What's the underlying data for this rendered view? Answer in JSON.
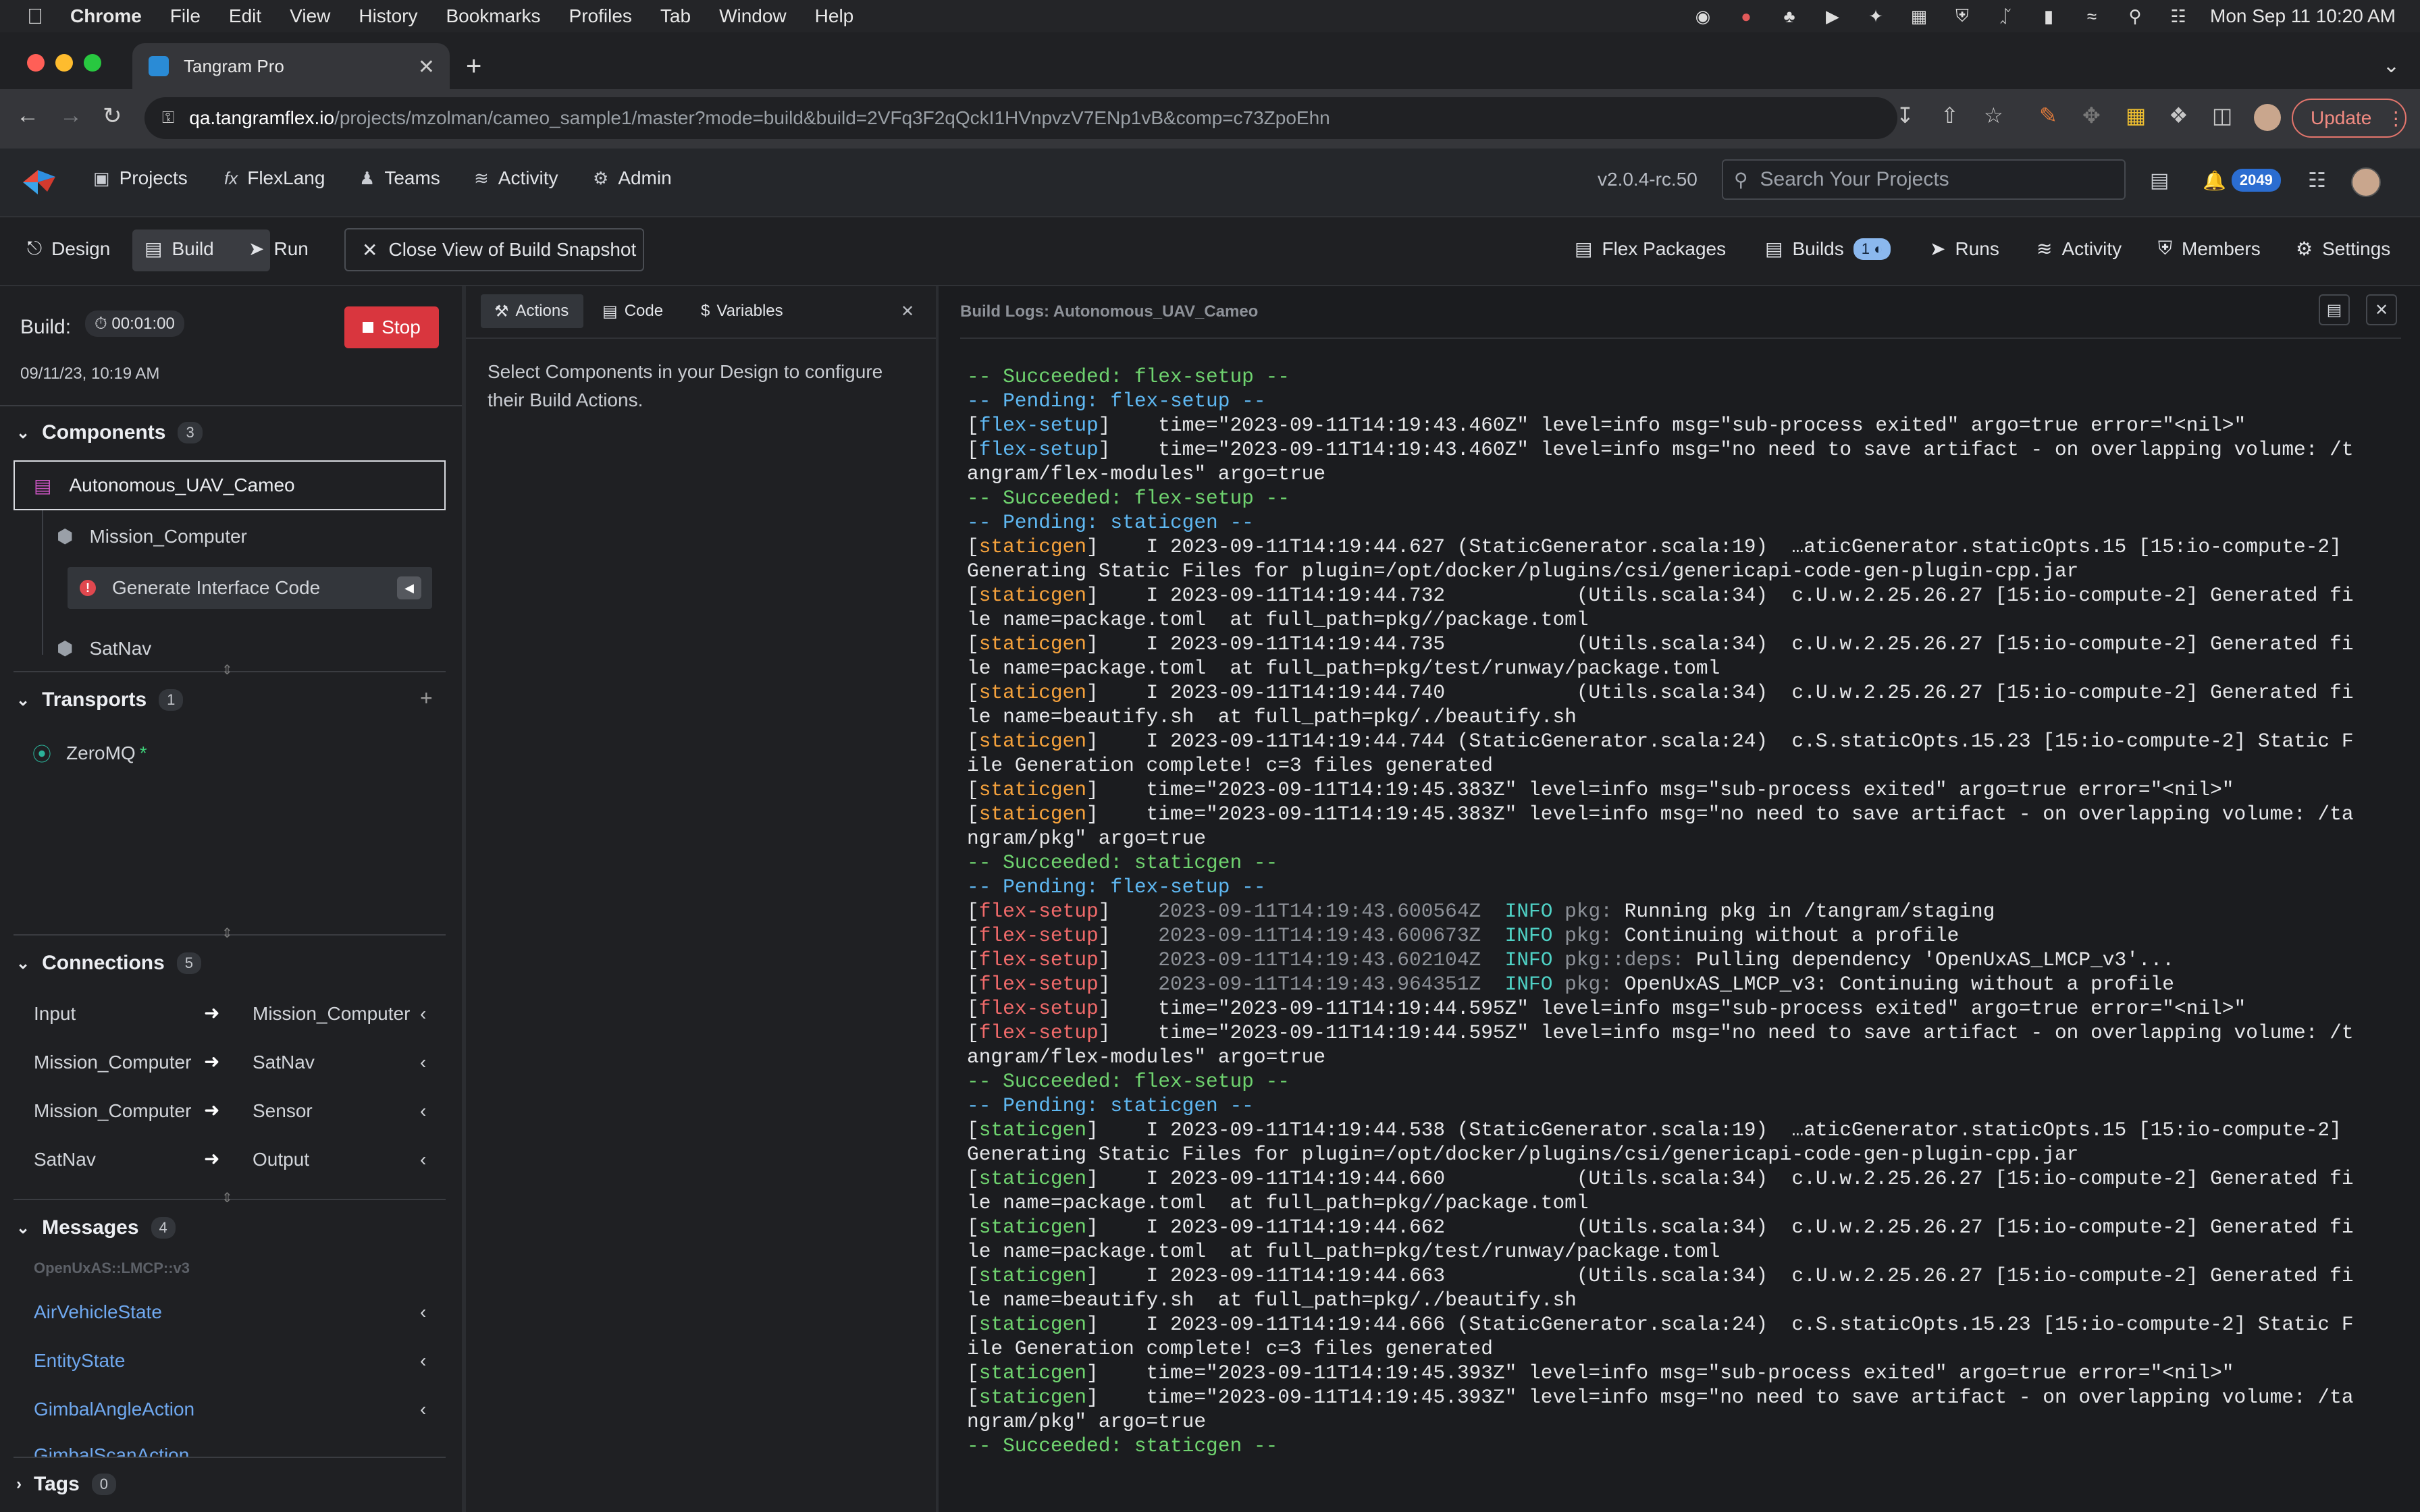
{
  "menubar": {
    "items": [
      "Chrome",
      "File",
      "Edit",
      "View",
      "History",
      "Bookmarks",
      "Profiles",
      "Tab",
      "Window",
      "Help"
    ],
    "clock": "Mon Sep 11  10:20 AM"
  },
  "browser": {
    "tab_title": "Tangram Pro",
    "url_host": "qa.tangramflex.io",
    "url_path": "/projects/mzolman/cameo_sample1/master?mode=build&build=2VFq3F2qQckI1HVnpvzV7ENp1vB&comp=c73ZpoEhn",
    "update_label": "Update"
  },
  "app_header": {
    "nav": [
      {
        "label": "Projects",
        "icon": "projects-icon"
      },
      {
        "label": "FlexLang",
        "icon": "fx-icon"
      },
      {
        "label": "Teams",
        "icon": "teams-icon"
      },
      {
        "label": "Activity",
        "icon": "activity-icon"
      },
      {
        "label": "Admin",
        "icon": "gear-icon"
      }
    ],
    "version": "v2.0.4-rc.50",
    "search_placeholder": "Search Your Projects",
    "notifications": "2049"
  },
  "project_header": {
    "modes": [
      "Design",
      "Build",
      "Run"
    ],
    "close_view": "Close View of Build Snapshot",
    "right_nav": [
      {
        "label": "Flex Packages"
      },
      {
        "label": "Builds",
        "badge": "1"
      },
      {
        "label": "Runs"
      },
      {
        "label": "Activity"
      },
      {
        "label": "Members"
      },
      {
        "label": "Settings"
      }
    ]
  },
  "build": {
    "label": "Build:",
    "timer": "00:01:00",
    "stop_label": "Stop",
    "date": "09/11/23, 10:19 AM"
  },
  "components": {
    "title": "Components",
    "count": "3",
    "selected": "Autonomous_UAV_Cameo",
    "items": [
      "Mission_Computer",
      "SatNav"
    ],
    "action": "Generate Interface Code"
  },
  "transports": {
    "title": "Transports",
    "count": "1",
    "items": [
      {
        "label": "ZeroMQ",
        "marker": "*"
      }
    ]
  },
  "connections": {
    "title": "Connections",
    "count": "5",
    "rows": [
      {
        "from": "Input",
        "to": "Mission_Computer"
      },
      {
        "from": "Mission_Computer",
        "to": "SatNav"
      },
      {
        "from": "Mission_Computer",
        "to": "Sensor"
      },
      {
        "from": "SatNav",
        "to": "Output"
      }
    ]
  },
  "messages": {
    "title": "Messages",
    "count": "4",
    "namespace": "OpenUxAS::LMCP::v3",
    "items": [
      "AirVehicleState",
      "EntityState",
      "GimbalAngleAction",
      "GimbalScanAction"
    ]
  },
  "tags": {
    "title": "Tags",
    "count": "0"
  },
  "middle": {
    "tabs": [
      "Actions",
      "Code",
      "Variables"
    ],
    "hint": "Select Components in your Design to configure their Build Actions."
  },
  "logs": {
    "title": "Build Logs: Autonomous_UAV_Cameo",
    "lines": [
      [
        [
          "-- Succeeded: flex-setup --",
          "g"
        ]
      ],
      [
        [
          "-- Pending: flex-setup --",
          "c"
        ]
      ],
      [
        [
          "[",
          "w"
        ],
        [
          "flex-setup",
          "c"
        ],
        [
          "]    time=\"2023-09-11T14:19:43.460Z\" level=info msg=\"sub-process exited\" argo=true error=\"<nil>\"",
          "w"
        ]
      ],
      [
        [
          "[",
          "w"
        ],
        [
          "flex-setup",
          "c"
        ],
        [
          "]    time=\"2023-09-11T14:19:43.460Z\" level=info msg=\"no need to save artifact - on overlapping volume: /t",
          "w"
        ]
      ],
      [
        [
          "angram/flex-modules\" argo=true",
          "w"
        ]
      ],
      [
        [
          "-- Succeeded: flex-setup --",
          "g"
        ]
      ],
      [
        [
          "-- Pending: staticgen --",
          "c"
        ]
      ],
      [
        [
          "[",
          "w"
        ],
        [
          "staticgen",
          "o"
        ],
        [
          "]    I 2023-09-11T14:19:44.627 (StaticGenerator.scala:19)  …aticGenerator.staticOpts.15 [15:io-compute-2]",
          "w"
        ]
      ],
      [
        [
          "Generating Static Files for plugin=/opt/docker/plugins/csi/genericapi-code-gen-plugin-cpp.jar",
          "w"
        ]
      ],
      [
        [
          "[",
          "w"
        ],
        [
          "staticgen",
          "o"
        ],
        [
          "]    I 2023-09-11T14:19:44.732           (Utils.scala:34)  c.U.w.2.25.26.27 [15:io-compute-2] Generated fi",
          "w"
        ]
      ],
      [
        [
          "le name=package.toml  at full_path=pkg//package.toml",
          "w"
        ]
      ],
      [
        [
          "[",
          "w"
        ],
        [
          "staticgen",
          "o"
        ],
        [
          "]    I 2023-09-11T14:19:44.735           (Utils.scala:34)  c.U.w.2.25.26.27 [15:io-compute-2] Generated fi",
          "w"
        ]
      ],
      [
        [
          "le name=package.toml  at full_path=pkg/test/runway/package.toml",
          "w"
        ]
      ],
      [
        [
          "[",
          "w"
        ],
        [
          "staticgen",
          "o"
        ],
        [
          "]    I 2023-09-11T14:19:44.740           (Utils.scala:34)  c.U.w.2.25.26.27 [15:io-compute-2] Generated fi",
          "w"
        ]
      ],
      [
        [
          "le name=beautify.sh  at full_path=pkg/./beautify.sh",
          "w"
        ]
      ],
      [
        [
          "[",
          "w"
        ],
        [
          "staticgen",
          "o"
        ],
        [
          "]    I 2023-09-11T14:19:44.744 (StaticGenerator.scala:24)  c.S.staticOpts.15.23 [15:io-compute-2] Static F",
          "w"
        ]
      ],
      [
        [
          "ile Generation complete! c=3 files generated",
          "w"
        ]
      ],
      [
        [
          "[",
          "w"
        ],
        [
          "staticgen",
          "o"
        ],
        [
          "]    time=\"2023-09-11T14:19:45.383Z\" level=info msg=\"sub-process exited\" argo=true error=\"<nil>\"",
          "w"
        ]
      ],
      [
        [
          "[",
          "w"
        ],
        [
          "staticgen",
          "o"
        ],
        [
          "]    time=\"2023-09-11T14:19:45.383Z\" level=info msg=\"no need to save artifact - on overlapping volume: /ta",
          "w"
        ]
      ],
      [
        [
          "ngram/pkg\" argo=true",
          "w"
        ]
      ],
      [
        [
          "-- Succeeded: staticgen --",
          "g"
        ]
      ],
      [
        [
          "-- Pending: flex-setup --",
          "c"
        ]
      ],
      [
        [
          "[",
          "w"
        ],
        [
          "flex-setup",
          "r"
        ],
        [
          "]    ",
          "w"
        ],
        [
          "2023-09-11T14:19:43.600564Z",
          "d"
        ],
        [
          "  ",
          "w"
        ],
        [
          "INFO",
          "t"
        ],
        [
          " ",
          "w"
        ],
        [
          "pkg:",
          "d"
        ],
        [
          " Running pkg in /tangram/staging",
          "w"
        ]
      ],
      [
        [
          "[",
          "w"
        ],
        [
          "flex-setup",
          "r"
        ],
        [
          "]    ",
          "w"
        ],
        [
          "2023-09-11T14:19:43.600673Z",
          "d"
        ],
        [
          "  ",
          "w"
        ],
        [
          "INFO",
          "t"
        ],
        [
          " ",
          "w"
        ],
        [
          "pkg:",
          "d"
        ],
        [
          " Continuing without a profile",
          "w"
        ]
      ],
      [
        [
          "[",
          "w"
        ],
        [
          "flex-setup",
          "r"
        ],
        [
          "]    ",
          "w"
        ],
        [
          "2023-09-11T14:19:43.602104Z",
          "d"
        ],
        [
          "  ",
          "w"
        ],
        [
          "INFO",
          "t"
        ],
        [
          " ",
          "w"
        ],
        [
          "pkg::deps:",
          "d"
        ],
        [
          " Pulling dependency 'OpenUxAS_LMCP_v3'...",
          "w"
        ]
      ],
      [
        [
          "[",
          "w"
        ],
        [
          "flex-setup",
          "r"
        ],
        [
          "]    ",
          "w"
        ],
        [
          "2023-09-11T14:19:43.964351Z",
          "d"
        ],
        [
          "  ",
          "w"
        ],
        [
          "INFO",
          "t"
        ],
        [
          " ",
          "w"
        ],
        [
          "pkg:",
          "d"
        ],
        [
          " OpenUxAS_LMCP_v3: Continuing without a profile",
          "w"
        ]
      ],
      [
        [
          "[",
          "w"
        ],
        [
          "flex-setup",
          "r"
        ],
        [
          "]    time=\"2023-09-11T14:19:44.595Z\" level=info msg=\"sub-process exited\" argo=true error=\"<nil>\"",
          "w"
        ]
      ],
      [
        [
          "[",
          "w"
        ],
        [
          "flex-setup",
          "r"
        ],
        [
          "]    time=\"2023-09-11T14:19:44.595Z\" level=info msg=\"no need to save artifact - on overlapping volume: /t",
          "w"
        ]
      ],
      [
        [
          "angram/flex-modules\" argo=true",
          "w"
        ]
      ],
      [
        [
          "-- Succeeded: flex-setup --",
          "g"
        ]
      ],
      [
        [
          "-- Pending: staticgen --",
          "c"
        ]
      ],
      [
        [
          "[",
          "w"
        ],
        [
          "staticgen",
          "g"
        ],
        [
          "]    I 2023-09-11T14:19:44.538 (StaticGenerator.scala:19)  …aticGenerator.staticOpts.15 [15:io-compute-2]",
          "w"
        ]
      ],
      [
        [
          "Generating Static Files for plugin=/opt/docker/plugins/csi/genericapi-code-gen-plugin-cpp.jar",
          "w"
        ]
      ],
      [
        [
          "[",
          "w"
        ],
        [
          "staticgen",
          "g"
        ],
        [
          "]    I 2023-09-11T14:19:44.660           (Utils.scala:34)  c.U.w.2.25.26.27 [15:io-compute-2] Generated fi",
          "w"
        ]
      ],
      [
        [
          "le name=package.toml  at full_path=pkg//package.toml",
          "w"
        ]
      ],
      [
        [
          "[",
          "w"
        ],
        [
          "staticgen",
          "g"
        ],
        [
          "]    I 2023-09-11T14:19:44.662           (Utils.scala:34)  c.U.w.2.25.26.27 [15:io-compute-2] Generated fi",
          "w"
        ]
      ],
      [
        [
          "le name=package.toml  at full_path=pkg/test/runway/package.toml",
          "w"
        ]
      ],
      [
        [
          "[",
          "w"
        ],
        [
          "staticgen",
          "g"
        ],
        [
          "]    I 2023-09-11T14:19:44.663           (Utils.scala:34)  c.U.w.2.25.26.27 [15:io-compute-2] Generated fi",
          "w"
        ]
      ],
      [
        [
          "le name=beautify.sh  at full_path=pkg/./beautify.sh",
          "w"
        ]
      ],
      [
        [
          "[",
          "w"
        ],
        [
          "staticgen",
          "g"
        ],
        [
          "]    I 2023-09-11T14:19:44.666 (StaticGenerator.scala:24)  c.S.staticOpts.15.23 [15:io-compute-2] Static F",
          "w"
        ]
      ],
      [
        [
          "ile Generation complete! c=3 files generated",
          "w"
        ]
      ],
      [
        [
          "[",
          "w"
        ],
        [
          "staticgen",
          "g"
        ],
        [
          "]    time=\"2023-09-11T14:19:45.393Z\" level=info msg=\"sub-process exited\" argo=true error=\"<nil>\"",
          "w"
        ]
      ],
      [
        [
          "[",
          "w"
        ],
        [
          "staticgen",
          "g"
        ],
        [
          "]    time=\"2023-09-11T14:19:45.393Z\" level=info msg=\"no need to save artifact - on overlapping volume: /ta",
          "w"
        ]
      ],
      [
        [
          "ngram/pkg\" argo=true",
          "w"
        ]
      ],
      [
        [
          "-- Succeeded: staticgen --",
          "g"
        ]
      ]
    ]
  },
  "colors": {
    "stop_red": "#d9363e",
    "accent_blue": "#2b6dd1",
    "log_green": "#6fd36f",
    "log_cyan": "#5fb8f2",
    "log_orange": "#f4a13c",
    "log_red": "#f06a6a"
  }
}
